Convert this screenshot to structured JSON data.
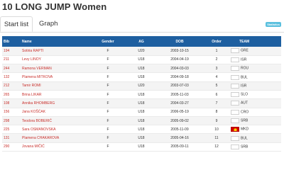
{
  "page": {
    "title": "10 LONG JUMP Women"
  },
  "tabs": [
    {
      "label": "Start list",
      "active": true
    },
    {
      "label": "Graph",
      "active": false
    }
  ],
  "badge": "Statistics",
  "table": {
    "headers": {
      "bib": "Bib",
      "name": "Name",
      "gender": "Gender",
      "ag": "AG",
      "dob": "DOB",
      "order": "Order",
      "team": "TEAM"
    },
    "rows": [
      {
        "bib": "194",
        "name": "Sotiria RAPTI",
        "gender": "F",
        "ag": "U20",
        "dob": "2003-10-15",
        "order": "1",
        "team": "GRE",
        "flag": "blank-flag-icon"
      },
      {
        "bib": "211",
        "name": "Levy LINOY",
        "gender": "F",
        "ag": "U18",
        "dob": "2004-04-19",
        "order": "2",
        "team": "ISR",
        "flag": "blank-flag-icon"
      },
      {
        "bib": "244",
        "name": "Ramona VERMAN",
        "gender": "F",
        "ag": "U18",
        "dob": "2004-03-03",
        "order": "3",
        "team": "ROU",
        "flag": "blank-flag-icon"
      },
      {
        "bib": "132",
        "name": "Plamena MITKOVA",
        "gender": "F",
        "ag": "U18",
        "dob": "2004-09-18",
        "order": "4",
        "team": "BUL",
        "flag": "blank-flag-icon"
      },
      {
        "bib": "212",
        "name": "Tamir ROMI",
        "gender": "F",
        "ag": "U20",
        "dob": "2003-07-03",
        "order": "5",
        "team": "ISR",
        "flag": "blank-flag-icon"
      },
      {
        "bib": "265",
        "name": "Brina LIKAR",
        "gender": "F",
        "ag": "U18",
        "dob": "2005-11-03",
        "order": "6",
        "team": "SLO",
        "flag": "blank-flag-icon"
      },
      {
        "bib": "108",
        "name": "Annika RHOMBERG",
        "gender": "F",
        "ag": "U18",
        "dob": "2004-03-27",
        "order": "7",
        "team": "AUT",
        "flag": "blank-flag-icon"
      },
      {
        "bib": "156",
        "name": "Jana KOŠĆAK",
        "gender": "F",
        "ag": "U18",
        "dob": "2006-05-19",
        "order": "8",
        "team": "CRO",
        "flag": "blank-flag-icon"
      },
      {
        "bib": "298",
        "name": "Teodora BOBERIĆ",
        "gender": "F",
        "ag": "U18",
        "dob": "2005-09-02",
        "order": "9",
        "team": "SRB",
        "flag": "blank-flag-icon"
      },
      {
        "bib": "225",
        "name": "Sara OSMANOVSKA",
        "gender": "F",
        "ag": "U18",
        "dob": "2005-11-09",
        "order": "10",
        "team": "MKD",
        "flag": "mkd-flag-icon"
      },
      {
        "bib": "131",
        "name": "Plamena CHAKAROVA",
        "gender": "F",
        "ag": "U18",
        "dob": "2005-04-16",
        "order": "11",
        "team": "BUL",
        "flag": "blank-flag-icon"
      },
      {
        "bib": "290",
        "name": "Jovana MIČIĆ",
        "gender": "F",
        "ag": "U18",
        "dob": "2005-09-11",
        "order": "12",
        "team": "SRB",
        "flag": "blank-flag-icon"
      }
    ]
  },
  "colors": {
    "header_bg": "#1e5fa0",
    "link_red": "#c9302c",
    "badge": "#5bc0de"
  }
}
